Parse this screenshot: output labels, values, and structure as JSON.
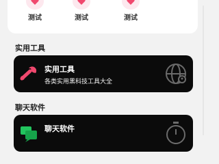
{
  "quick_actions": [
    {
      "label": "测试",
      "icon": "heart-icon"
    },
    {
      "label": "测试",
      "icon": "heart-icon"
    },
    {
      "label": "测试",
      "icon": "heart-icon"
    }
  ],
  "sections": [
    {
      "title": "实用工具",
      "card": {
        "title": "实用工具",
        "subtitle": "各类实用黑科技工具大全",
        "icon": "wrench-icon",
        "decor_icon": "globe-icon"
      }
    },
    {
      "title": "聊天软件",
      "card": {
        "title": "聊天软件",
        "subtitle": "",
        "icon": "chat-icon",
        "decor_icon": "timer-icon"
      }
    }
  ],
  "colors": {
    "accent": "#f0486e",
    "chat_green": "#22c55e",
    "card_bg": "#0b0b0b",
    "page_bg": "#f2f2f2"
  }
}
